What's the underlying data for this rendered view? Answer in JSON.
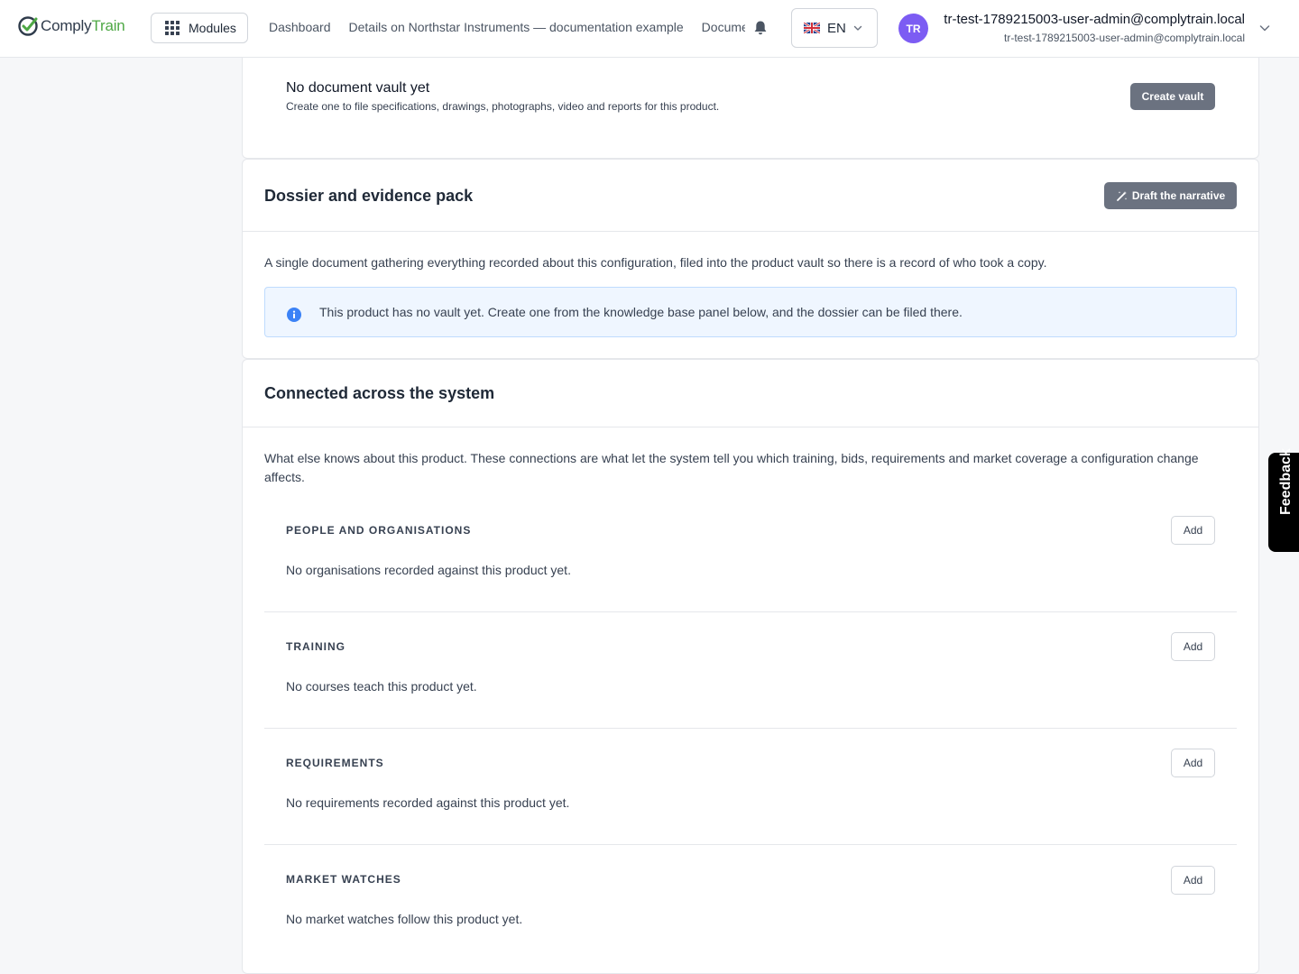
{
  "brand": {
    "name_part1": "Comply",
    "name_part2": "Train"
  },
  "topbar": {
    "modules_label": "Modules",
    "breadcrumbs": [
      "Dashboard",
      "Details on Northstar Instruments — documentation example",
      "Documentation"
    ],
    "language": "EN",
    "user": {
      "initials": "TR",
      "name": "tr-test-1789215003-user-admin@complytrain.local",
      "email": "tr-test-1789215003-user-admin@complytrain.local"
    }
  },
  "vault": {
    "title": "No document vault yet",
    "subtitle": "Create one to file specifications, drawings, photographs, video and reports for this product.",
    "create_label": "Create vault"
  },
  "dossier": {
    "title": "Dossier and evidence pack",
    "draft_label": "Draft the narrative",
    "description": "A single document gathering everything recorded about this configuration, filed into the product vault so there is a record of who took a copy.",
    "info": "This product has no vault yet. Create one from the knowledge base panel below, and the dossier can be filed there."
  },
  "connected": {
    "title": "Connected across the system",
    "description": "What else knows about this product. These connections are what let the system tell you which training, bids, requirements and market coverage a configuration change affects.",
    "add_label": "Add",
    "sections": [
      {
        "label": "PEOPLE AND ORGANISATIONS",
        "empty": "No organisations recorded against this product yet."
      },
      {
        "label": "TRAINING",
        "empty": "No courses teach this product yet."
      },
      {
        "label": "REQUIREMENTS",
        "empty": "No requirements recorded against this product yet."
      },
      {
        "label": "MARKET WATCHES",
        "empty": "No market watches follow this product yet."
      }
    ]
  },
  "feedback_label": "Feedback",
  "colors": {
    "brand_green": "#4ea845",
    "avatar": "#7c5cf3",
    "info_bg": "#eff6ff",
    "info_icon": "#3b82f6"
  }
}
